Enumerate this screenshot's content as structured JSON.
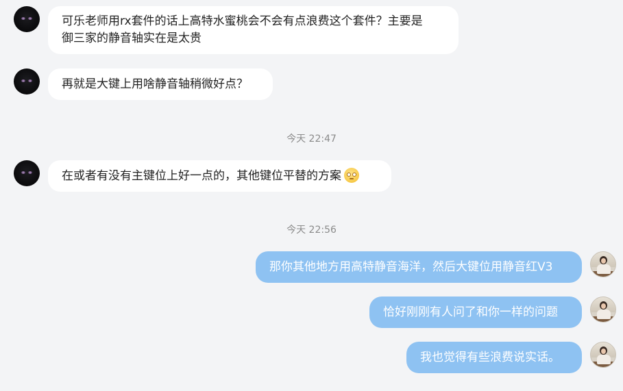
{
  "messages": [
    {
      "side": "in",
      "lines": [
        "可乐老师用rx套件的话上高特水蜜桃会不会有点浪费这个套件？主要是",
        "御三家的静音轴实在是太贵"
      ]
    },
    {
      "side": "in",
      "text": "再就是大键上用啥静音轴稍微好点？"
    },
    {
      "side": "time",
      "text": "今天 22:47"
    },
    {
      "side": "in",
      "text": "在或者有没有主键位上好一点的，其他键位平替的方案",
      "emoji": "sweat-smile-emoji"
    },
    {
      "side": "time",
      "text": "今天 22:56"
    },
    {
      "side": "out",
      "text": "那你其他地方用高特静音海洋，然后大键位用静音红V3"
    },
    {
      "side": "out",
      "text": "恰好刚刚有人问了和你一样的问题"
    },
    {
      "side": "out",
      "text": "我也觉得有些浪费说实话。"
    }
  ],
  "colors": {
    "background": "#f3f4f6",
    "incoming_bubble": "#ffffff",
    "outgoing_bubble": "#8ec2f2",
    "timestamp_text": "#8a8a8a"
  },
  "icons": {
    "incoming_avatar": "dark-avatar-icon",
    "outgoing_avatar": "photo-avatar-icon"
  }
}
